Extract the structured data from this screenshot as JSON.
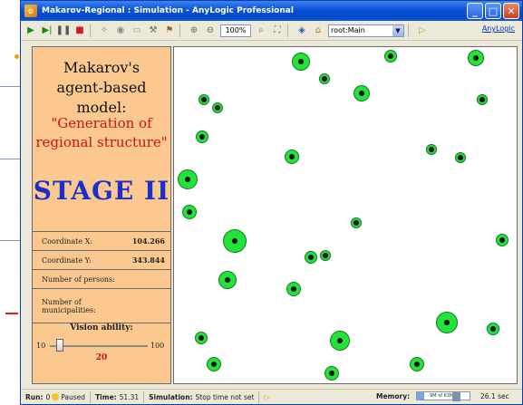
{
  "window": {
    "title": "Makarov-Regional : Simulation - AnyLogic Professional",
    "min_label": "_",
    "max_label": "□",
    "close_label": "✕"
  },
  "toolbar": {
    "zoom": "100%",
    "root_select": "root:Main",
    "link": "AnyLogic"
  },
  "panel": {
    "title_line1": "Makarov's",
    "title_line2": "agent-based model:",
    "subtitle_line1": "\"Generation of",
    "subtitle_line2": "regional structure\"",
    "stage": "STAGE II",
    "rows": [
      {
        "label": "Coordinate X:",
        "value": "104.266"
      },
      {
        "label": "Coordinate Y:",
        "value": "343.844"
      },
      {
        "label": "Number of persons:",
        "value": ""
      },
      {
        "label": "Number of municipalities:",
        "value": ""
      }
    ],
    "vision": {
      "label": "Vision ability:",
      "min": "10",
      "max": "100",
      "value": "20",
      "level": 0.11
    }
  },
  "statusbar": {
    "run_label": "Run:",
    "run_value": "0",
    "state": "Paused",
    "time_label": "Time:",
    "time_value": "51.31",
    "simulation_label": "Simulation:",
    "simulation_value": "Stop time not set",
    "memory_label": "Memory:",
    "memory_value": "9M of 63M",
    "sim_time": "26.1 sec"
  },
  "colors": {
    "panel_bg": "#fbc98f",
    "agent_fill": "#22e33a",
    "stage_color": "#1c2fc8",
    "subtitle_color": "#cc1111"
  }
}
